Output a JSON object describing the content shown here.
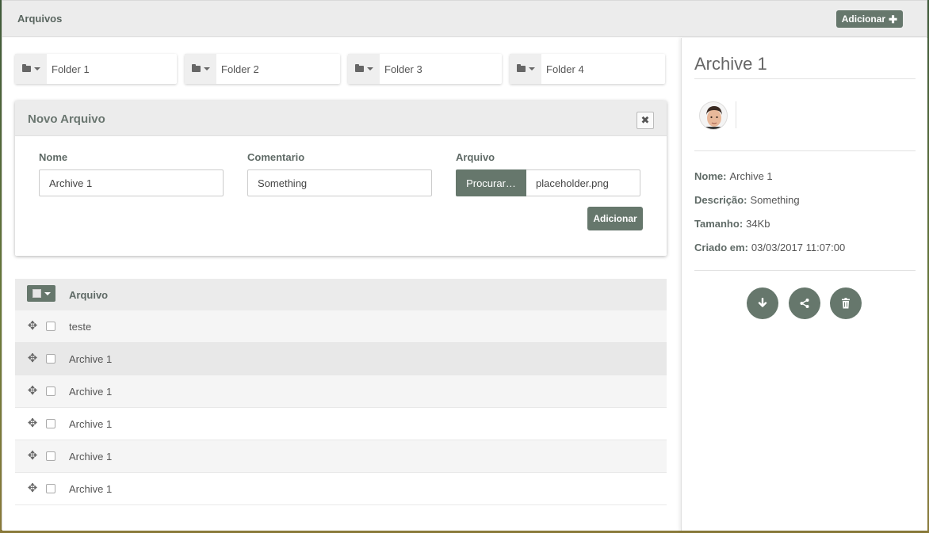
{
  "header": {
    "title": "Arquivos",
    "add_label": "Adicionar"
  },
  "folders": [
    {
      "name": "Folder 1"
    },
    {
      "name": "Folder 2"
    },
    {
      "name": "Folder 3"
    },
    {
      "name": "Folder 4"
    }
  ],
  "form": {
    "title": "Novo Arquivo",
    "name_label": "Nome",
    "name_value": "Archive 1",
    "comment_label": "Comentario",
    "comment_value": "Something",
    "file_label": "Arquivo",
    "browse_label": "Procurar…",
    "file_value": "placeholder.png",
    "submit_label": "Adicionar"
  },
  "table": {
    "column": "Arquivo",
    "rows": [
      "teste",
      "Archive 1",
      "Archive 1",
      "Archive 1",
      "Archive 1",
      "Archive 1"
    ]
  },
  "detail": {
    "title": "Archive 1",
    "name_label": "Nome:",
    "name_value": "Archive 1",
    "desc_label": "Descrição:",
    "desc_value": "Something",
    "size_label": "Tamanho:",
    "size_value": "34Kb",
    "created_label": "Criado em:",
    "created_value": "03/03/2017 11:07:00"
  },
  "icons": {
    "add": "plus-icon",
    "folder": "folder-icon",
    "close": "close-icon",
    "move": "move-icon",
    "download": "download-icon",
    "share": "share-icon",
    "delete": "trash-icon"
  },
  "colors": {
    "accent": "#66776c"
  }
}
